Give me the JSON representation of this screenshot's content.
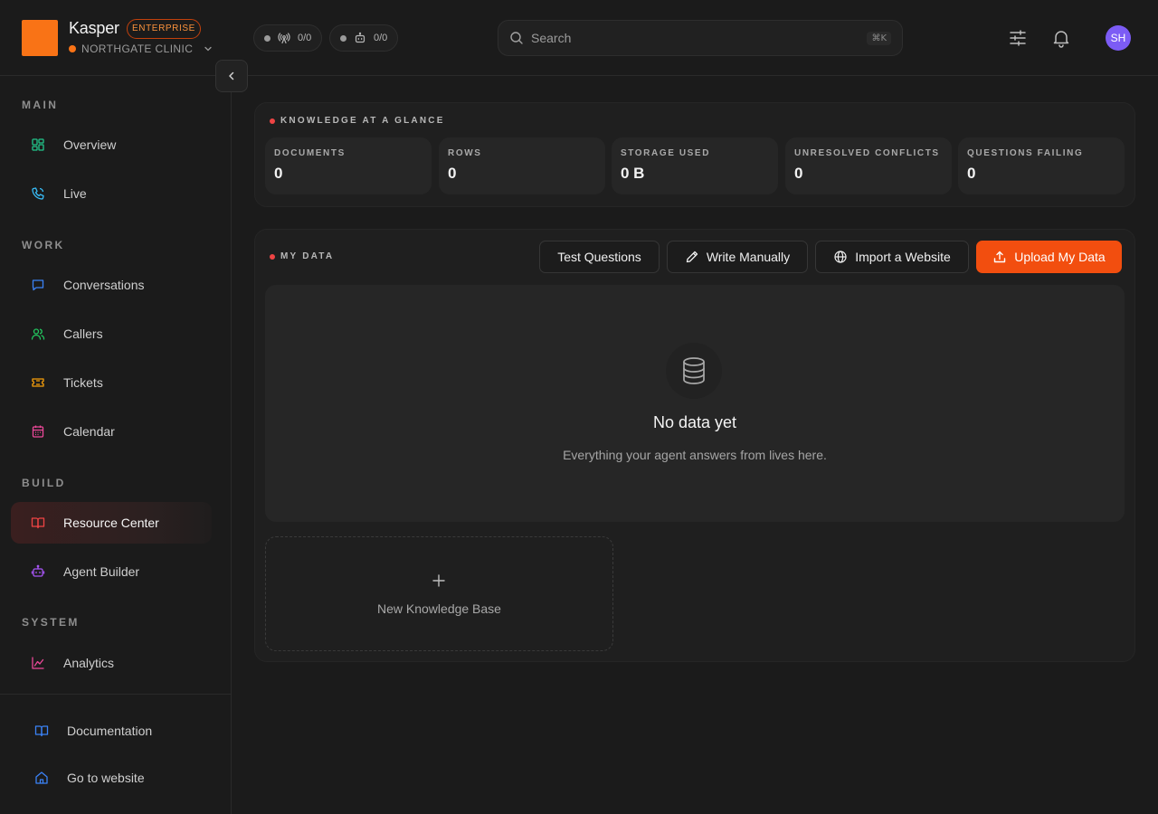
{
  "brand": {
    "name": "Kasper",
    "plan": "ENTERPRISE",
    "org": "NORTHGATE CLINIC"
  },
  "status_pills": [
    {
      "icon": "antenna-icon",
      "count": "0/0"
    },
    {
      "icon": "bot-icon",
      "count": "0/0"
    }
  ],
  "search": {
    "placeholder": "Search",
    "shortcut": "⌘K"
  },
  "user": {
    "initials": "SH"
  },
  "sidebar": {
    "sections": {
      "main": "MAIN",
      "work": "WORK",
      "build": "BUILD",
      "system": "SYSTEM"
    },
    "items": {
      "overview": "Overview",
      "live": "Live",
      "conversations": "Conversations",
      "callers": "Callers",
      "tickets": "Tickets",
      "calendar": "Calendar",
      "resource_center": "Resource Center",
      "agent_builder": "Agent Builder",
      "analytics": "Analytics"
    },
    "footer": {
      "documentation": "Documentation",
      "website": "Go to website"
    },
    "active": "Resource Center"
  },
  "glance": {
    "title": "KNOWLEDGE AT A GLANCE",
    "stats": [
      {
        "label": "DOCUMENTS",
        "value": "0"
      },
      {
        "label": "ROWS",
        "value": "0"
      },
      {
        "label": "STORAGE USED",
        "value": "0 B"
      },
      {
        "label": "UNRESOLVED CONFLICTS",
        "value": "0"
      },
      {
        "label": "QUESTIONS FAILING",
        "value": "0"
      }
    ]
  },
  "my_data": {
    "title": "MY DATA",
    "buttons": {
      "test": "Test Questions",
      "write": "Write Manually",
      "import": "Import a Website",
      "upload": "Upload My Data"
    },
    "empty": {
      "title": "No data yet",
      "subtitle": "Everything your agent answers from lives here."
    },
    "new_kb": "New Knowledge Base"
  },
  "colors": {
    "accent": "#f24e0f",
    "brand_square": "#f97316",
    "avatar": "#7c5cf5",
    "status_dot": "#ef4444"
  }
}
